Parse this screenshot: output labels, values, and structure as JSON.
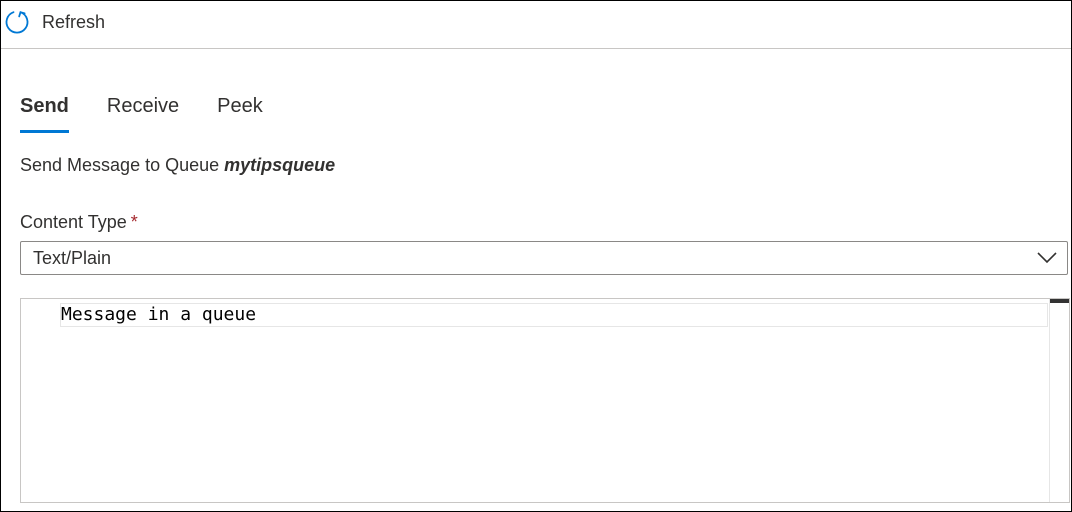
{
  "toolbar": {
    "refresh_label": "Refresh",
    "refresh_icon": "refresh-icon"
  },
  "tabs": [
    {
      "label": "Send",
      "active": true
    },
    {
      "label": "Receive",
      "active": false
    },
    {
      "label": "Peek",
      "active": false
    }
  ],
  "send": {
    "subtitle_prefix": "Send Message to Queue ",
    "queue_name": "mytipsqueue",
    "content_type": {
      "label": "Content Type",
      "required_mark": "*",
      "selected": "Text/Plain",
      "icon": "chevron-down-icon"
    },
    "message_body": "Message in a queue"
  },
  "colors": {
    "accent": "#0078d4",
    "required": "#a4262c",
    "text": "#323130",
    "border": "#8a8886"
  }
}
